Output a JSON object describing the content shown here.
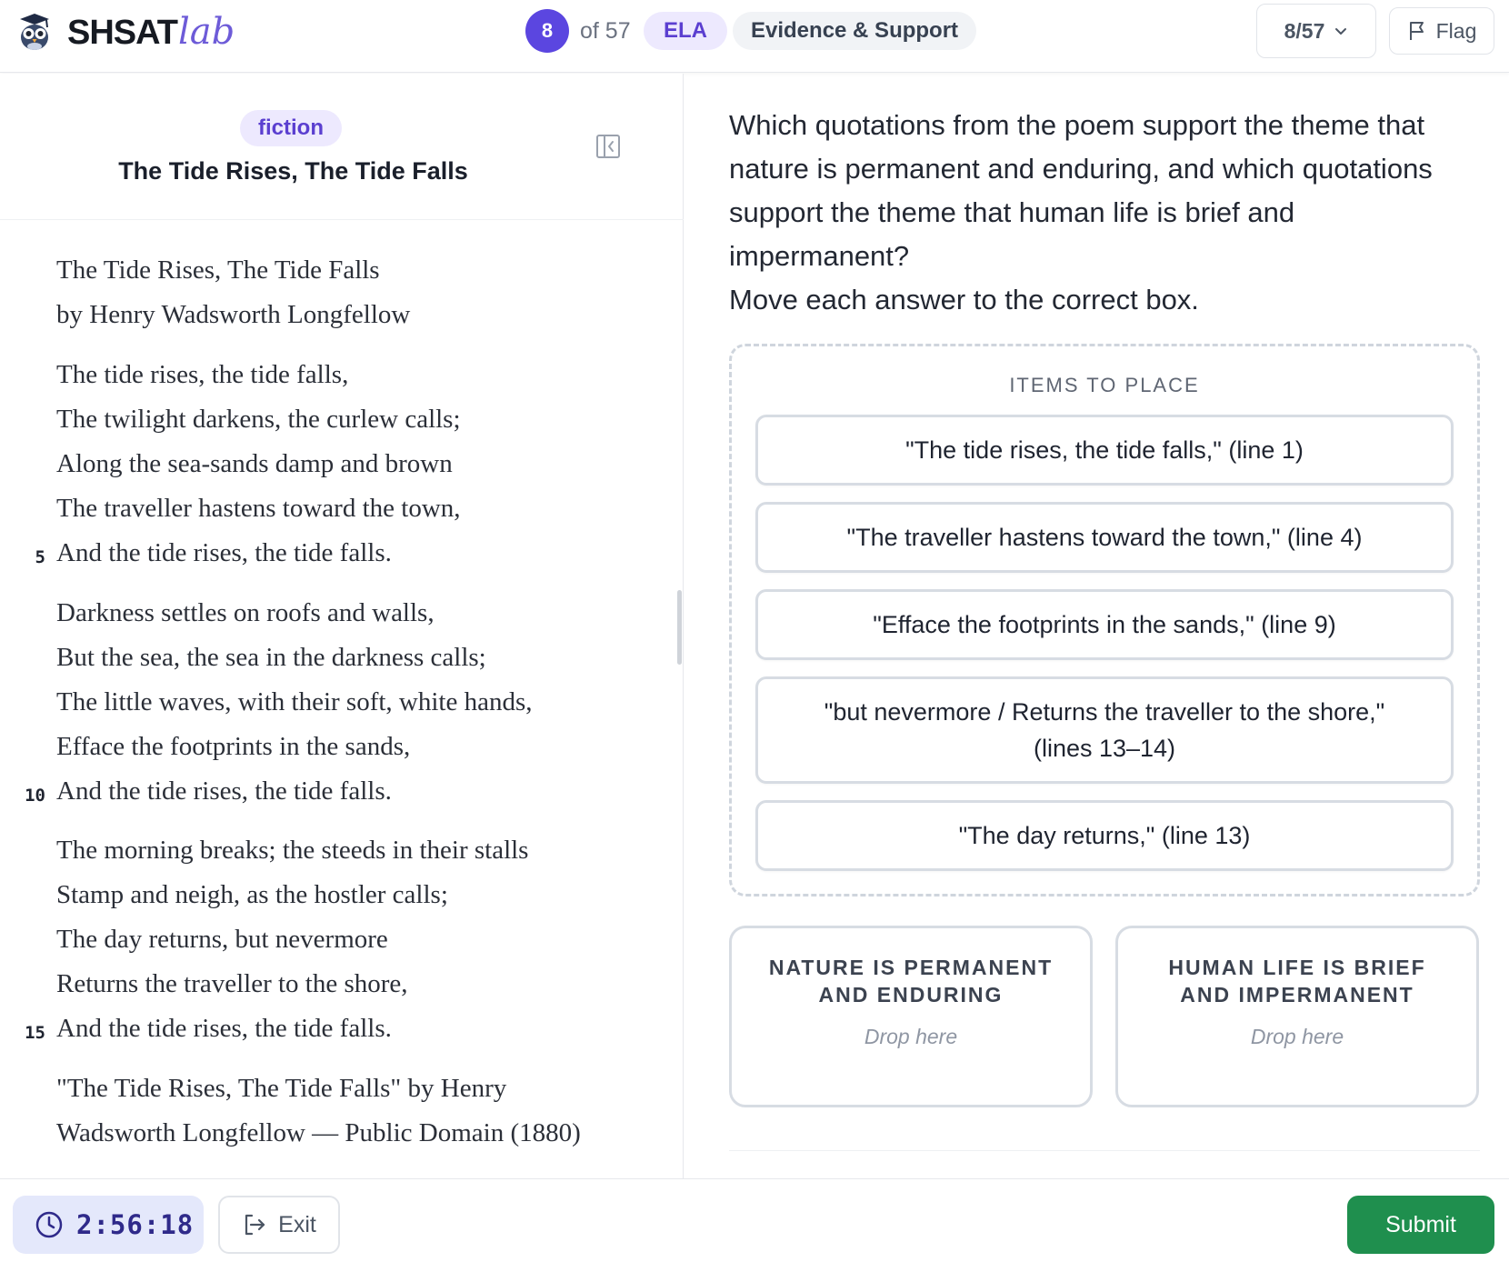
{
  "header": {
    "logo_main": "SHSAT",
    "logo_accent": "lab",
    "question_number": "8",
    "question_of": "of 57",
    "subject": "ELA",
    "category": "Evidence & Support",
    "nav_select": "8/57",
    "flag_label": "Flag"
  },
  "passage": {
    "genre": "fiction",
    "title": "The Tide Rises, The Tide Falls",
    "lines": [
      "The Tide Rises, The Tide Falls",
      "by Henry Wadsworth Longfellow",
      "The tide rises, the tide falls,",
      "The twilight darkens, the curlew calls;",
      "Along the sea-sands damp and brown",
      "The traveller hastens toward the town,",
      "And the tide rises, the tide falls.",
      "Darkness settles on roofs and walls,",
      "But the sea, the sea in the darkness calls;",
      "The little waves, with their soft, white hands,",
      "Efface the footprints in the sands,",
      "And the tide rises, the tide falls.",
      "The morning breaks; the steeds in their stalls",
      "Stamp and neigh, as the hostler calls;",
      "The day returns, but nevermore",
      "Returns the traveller to the shore,",
      "And the tide rises, the tide falls.",
      "\"The Tide Rises, The Tide Falls\" by Henry",
      "Wadsworth Longfellow — Public Domain (1880)"
    ],
    "line_numbers": [
      "5",
      "10",
      "15"
    ]
  },
  "question": {
    "prompt": "Which quotations from the poem support the theme that nature is permanent and enduring, and which quotations support the theme that human life is brief and impermanent?",
    "instruction": "Move each answer to the correct box."
  },
  "items_box": {
    "title": "ITEMS TO PLACE",
    "items": [
      "\"The tide rises, the tide falls,\" (line 1)",
      "\"The traveller hastens toward the town,\" (line 4)",
      "\"Efface the footprints in the sands,\" (line 9)",
      "\"but nevermore / Returns the traveller to the shore,\" (lines 13–14)",
      "\"The day returns,\" (line 13)"
    ]
  },
  "drop_zones": [
    {
      "title": "NATURE IS PERMANENT AND ENDURING",
      "hint": "Drop here"
    },
    {
      "title": "HUMAN LIFE IS BRIEF AND IMPERMANENT",
      "hint": "Drop here"
    }
  ],
  "footer": {
    "timer": "2:56:18",
    "exit_label": "Exit",
    "submit_label": "Submit"
  },
  "colors": {
    "accent": "#5b46e0",
    "pill_bg": "#ede9fe",
    "submit": "#1f8f4e",
    "timer_bg": "#e4e8fb"
  },
  "icons": [
    "owl-logo-icon",
    "chevron-down-icon",
    "flag-icon",
    "collapse-panel-icon",
    "clock-icon",
    "exit-icon"
  ]
}
